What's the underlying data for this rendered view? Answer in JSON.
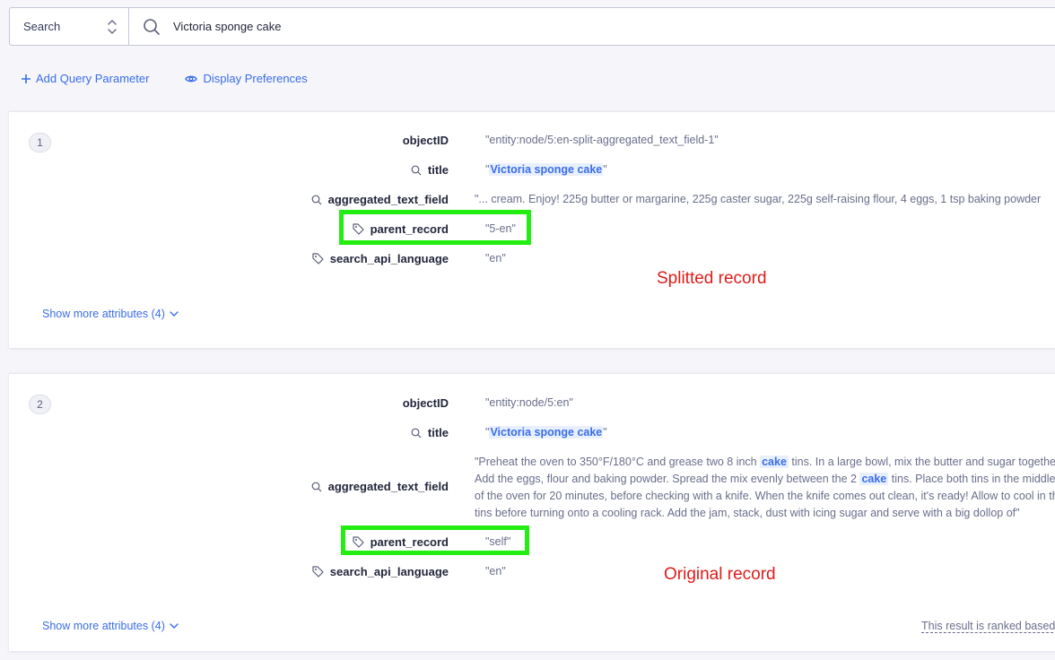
{
  "search": {
    "mode": "Search",
    "query": "Victoria sponge cake"
  },
  "actions": {
    "add_query": "Add Query Parameter",
    "display_prefs": "Display Preferences"
  },
  "results": [
    {
      "rank": "1",
      "attributes": {
        "objectID": {
          "name": "objectID",
          "value": "\"entity:node/5:en-split-aggregated_text_field-1\""
        },
        "title": {
          "name": "title",
          "prefix": "\"",
          "highlight": "Victoria sponge cake",
          "suffix": "\""
        },
        "aggregated": {
          "name": "aggregated_text_field",
          "value": "\"... cream. Enjoy! 225g butter or margarine, 225g caster sugar, 225g self-raising flour, 4 eggs, 1 tsp baking powder"
        },
        "parent": {
          "name": "parent_record",
          "value": "\"5-en\""
        },
        "lang": {
          "name": "search_api_language",
          "value": "\"en\""
        }
      },
      "show_more": "Show more attributes (4)",
      "annotation": "Splitted record"
    },
    {
      "rank": "2",
      "attributes": {
        "objectID": {
          "name": "objectID",
          "value": "\"entity:node/5:en\""
        },
        "title": {
          "name": "title",
          "prefix": "\"",
          "highlight": "Victoria sponge cake",
          "suffix": "\""
        },
        "aggregated": {
          "name": "aggregated_text_field",
          "p1": "\"Preheat the oven to 350°F/180°C and grease two 8 inch ",
          "h1": "cake",
          "p2": " tins. In a large bowl, mix the butter and sugar together. Add the eggs, flour and baking powder. Spread the mix evenly between the 2 ",
          "h2": "cake",
          "p3": " tins. Place both tins in the middle of the oven for 20 minutes, before checking with a knife. When the knife comes out clean, it's ready! Allow to cool in the tins before turning onto a cooling rack. Add the jam, stack, dust with icing sugar and serve with a big dollop of\""
        },
        "parent": {
          "name": "parent_record",
          "value": "\"self\""
        },
        "lang": {
          "name": "search_api_language",
          "value": "\"en\""
        }
      },
      "show_more": "Show more attributes (4)",
      "annotation": "Original record",
      "ranked_note": "This result is ranked based on"
    }
  ],
  "colors": {
    "accent": "#3a6ee8",
    "highlight_box": "#22ee11",
    "annotation": "#e01a1a"
  }
}
